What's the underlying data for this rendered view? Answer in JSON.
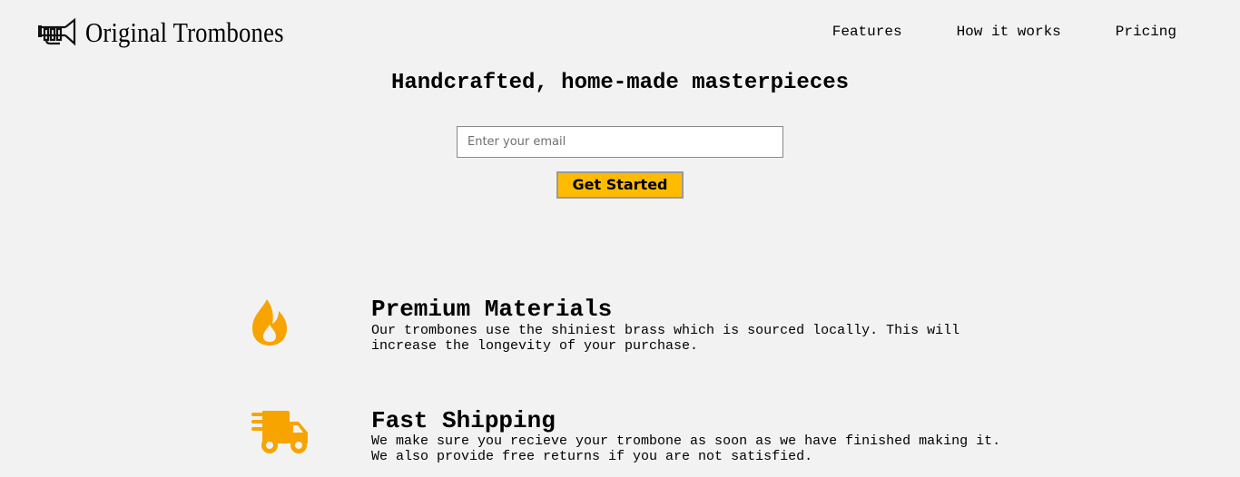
{
  "header": {
    "brand": "Original Trombones",
    "logo_icon": "trombone-icon",
    "nav": [
      {
        "label": "Features"
      },
      {
        "label": "How it works"
      },
      {
        "label": "Pricing"
      }
    ]
  },
  "hero": {
    "title": "Handcrafted, home-made masterpieces",
    "email_placeholder": "Enter your email",
    "cta_label": "Get Started"
  },
  "features": [
    {
      "icon": "fire-icon",
      "title": "Premium Materials",
      "description": "Our trombones use the shiniest brass which is sourced locally. This will increase the longevity of your purchase."
    },
    {
      "icon": "shipping-truck-icon",
      "title": "Fast Shipping",
      "description": "We make sure you recieve your trombone as soon as we have finished making it. We also provide free returns if you are not satisfied."
    }
  ],
  "colors": {
    "background": "#f2f2f2",
    "accent": "#ffbb00",
    "icon": "#f7a400"
  }
}
